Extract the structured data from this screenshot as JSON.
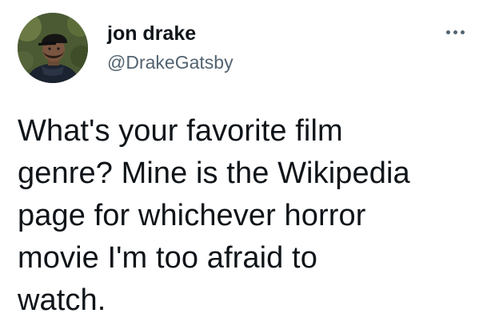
{
  "author": {
    "display_name": "jon drake",
    "handle": "@DrakeGatsby",
    "avatar_icon": "user-avatar-photo"
  },
  "menu": {
    "icon": "more-options-icon"
  },
  "tweet": {
    "lines": [
      "What's your favorite film",
      "genre? Mine is the Wikipedia",
      "page for whichever horror",
      "movie I'm too afraid to",
      "watch."
    ]
  },
  "colors": {
    "text_primary": "#0f1419",
    "text_secondary": "#536471",
    "background": "#ffffff"
  }
}
